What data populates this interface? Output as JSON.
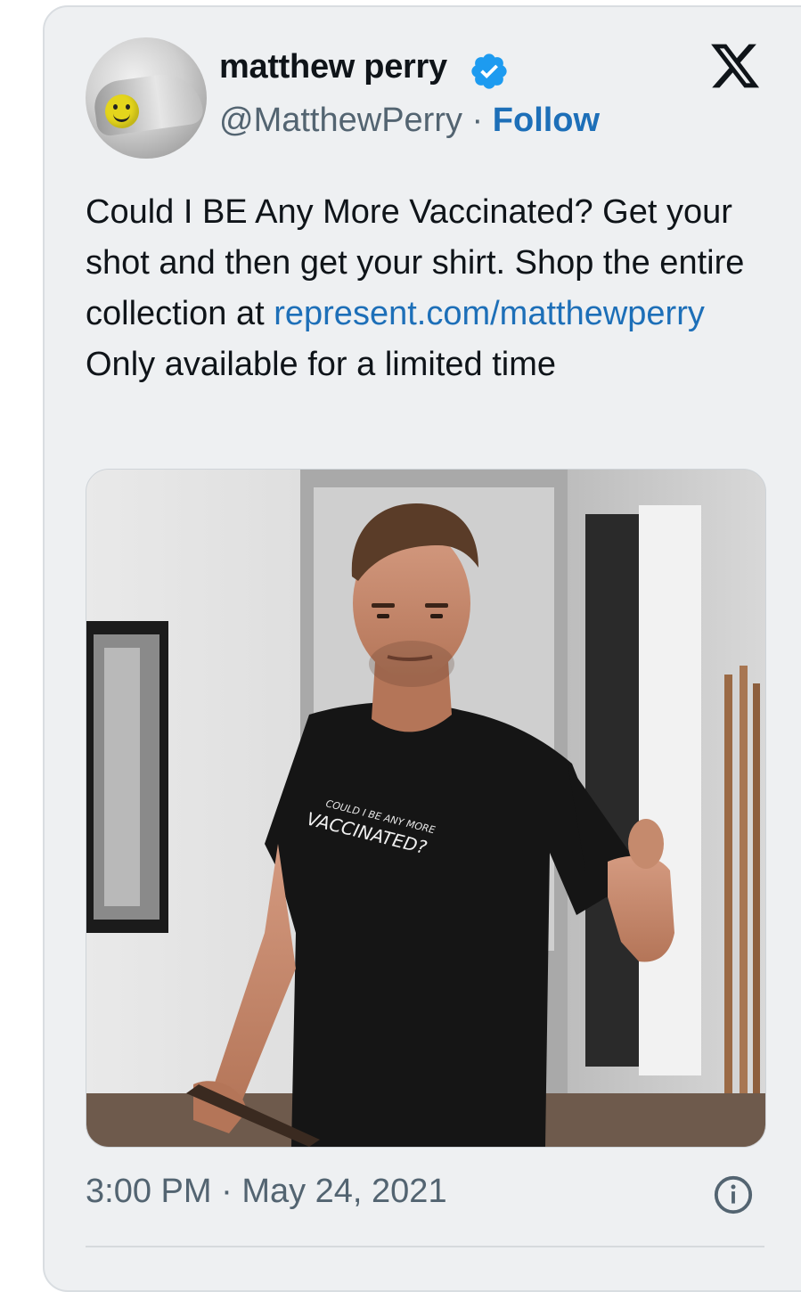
{
  "tweet": {
    "display_name": "matthew perry",
    "handle": "@MatthewPerry",
    "separator": "·",
    "follow_label": "Follow",
    "text_before_link": "Could I BE Any More Vaccinated? Get your shot and then get your shirt. Shop the entire collection at ",
    "link_text": "represent.com/matthewperry",
    "text_after_link": " Only available for a limited time",
    "shirt_line_1": "COULD I BE ANY MORE",
    "shirt_line_2": "VACCINATED?",
    "time": "3:00 PM",
    "date": "May 24, 2021"
  },
  "icons": {
    "verified": "verified-badge-icon",
    "platform": "x-logo-icon",
    "info": "info-icon"
  },
  "colors": {
    "card_background": "#eef0f2",
    "link": "#1d6fb8",
    "verified": "#1d9bf0",
    "text_primary": "#0f1419",
    "text_secondary": "#536471"
  }
}
